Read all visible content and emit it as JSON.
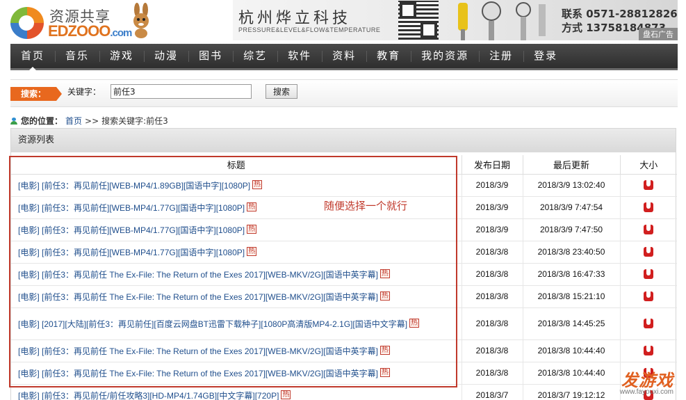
{
  "logo": {
    "title": "资源共享",
    "brand": "EDZOOO",
    "domain": ".com"
  },
  "ad": {
    "company": "杭州烨立科技",
    "tagline": "PRESSURE&LEVEL&FLOW&TEMPERATURE",
    "phone_label": "联系 0571-28812826",
    "mobile_label": "方式 13758184873",
    "badge": "盘石广告"
  },
  "nav": {
    "items": [
      "首页",
      "音乐",
      "游戏",
      "动漫",
      "图书",
      "综艺",
      "软件",
      "资料",
      "教育",
      "我的资源",
      "注册",
      "登录"
    ]
  },
  "search": {
    "tag": "搜索：",
    "label": "关键字：",
    "value": "前任3",
    "button": "搜索"
  },
  "breadcrumb": {
    "prefix": "您的位置：",
    "home": "首页",
    "sep": ">>",
    "current": "搜索关键字:前任3"
  },
  "list": {
    "header": "资源列表",
    "columns": [
      "标题",
      "发布日期",
      "最后更新",
      "大小"
    ],
    "hot_label": "热",
    "rows": [
      {
        "title": "[电影] [前任3：再见前任][WEB-MP4/1.89GB][国语中字][1080P]",
        "date": "2018/3/9",
        "updated": "2018/3/9 13:02:40"
      },
      {
        "title": "[电影] [前任3：再见前任][WEB-MP4/1.77G][国语中字][1080P]",
        "date": "2018/3/9",
        "updated": "2018/3/9 7:47:54"
      },
      {
        "title": "[电影] [前任3：再见前任][WEB-MP4/1.77G][国语中字][1080P]",
        "date": "2018/3/9",
        "updated": "2018/3/9 7:47:50"
      },
      {
        "title": "[电影] [前任3：再见前任][WEB-MP4/1.77G][国语中字][1080P]",
        "date": "2018/3/8",
        "updated": "2018/3/8 23:40:50"
      },
      {
        "title": "[电影] [前任3：再见前任 The Ex-File: The Return of the Exes 2017][WEB-MKV/2G][国语中英字幕]",
        "date": "2018/3/8",
        "updated": "2018/3/8 16:47:33"
      },
      {
        "title": "[电影] [前任3：再见前任 The Ex-File: The Return of the Exes 2017][WEB-MKV/2G][国语中英字幕]",
        "date": "2018/3/8",
        "updated": "2018/3/8 15:21:10"
      },
      {
        "title": "[电影] [2017][大陆][前任3：再见前任][百度云网盘BT迅雷下载种子][1080P高清版MP4-2.1G][国语中文字幕]",
        "date": "2018/3/8",
        "updated": "2018/3/8 14:45:25"
      },
      {
        "title": "[电影] [前任3：再见前任 The Ex-File: The Return of the Exes 2017][WEB-MKV/2G][国语中英字幕]",
        "date": "2018/3/8",
        "updated": "2018/3/8 10:44:40"
      },
      {
        "title": "[电影] [前任3：再见前任 The Ex-File: The Return of the Exes 2017][WEB-MKV/2G][国语中英字幕]",
        "date": "2018/3/8",
        "updated": "2018/3/8 10:44:40"
      },
      {
        "title": "[电影] [前任3：再见前任/前任攻略3][HD-MP4/1.74GB][中文字幕][720P]",
        "date": "2018/3/7",
        "updated": "2018/3/7 19:12:12"
      }
    ]
  },
  "annotation": {
    "text": "随便选择一个就行"
  },
  "watermark": {
    "main": "发游戏",
    "sub": "www.fayouxi.com"
  }
}
